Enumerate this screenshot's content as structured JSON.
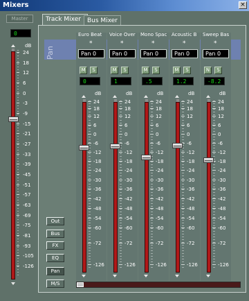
{
  "window": {
    "title": "Mixers",
    "close_glyph": "×"
  },
  "master": {
    "label": "Master",
    "value": "0",
    "level_db": 0
  },
  "tabs": [
    {
      "label": "Track Mixer",
      "active": true
    },
    {
      "label": "Bus Mixer",
      "active": false
    }
  ],
  "pan_section_label": "Pan",
  "channels": [
    {
      "name": "Euro Beat",
      "pan": "Pan 0",
      "mute": "M",
      "solo": "S",
      "value": "0",
      "level_db": 0
    },
    {
      "name": "Voice Over",
      "pan": "Pan 0",
      "mute": "M",
      "solo": "S",
      "value": "1",
      "level_db": 1
    },
    {
      "name": "Mono Spac",
      "pan": "Pan 0",
      "mute": "M",
      "solo": "S",
      "value": ".5",
      "level_db": -6.5
    },
    {
      "name": "Acoustic B",
      "pan": "Pan 0",
      "mute": "M",
      "solo": "S",
      "value": "1.2",
      "level_db": 1.2
    },
    {
      "name": "Sweep Bas",
      "pan": "Pan 0",
      "mute": "N",
      "solo": "S",
      "value": "-8.2",
      "level_db": -8.2
    }
  ],
  "pan_star": "*",
  "side_buttons": [
    {
      "label": "Out",
      "active": false
    },
    {
      "label": "Bus",
      "active": false
    },
    {
      "label": "FX",
      "active": false
    },
    {
      "label": "EQ",
      "active": false
    },
    {
      "label": "Pan",
      "active": true
    },
    {
      "label": "M/S",
      "active": false
    }
  ],
  "channel_scale": {
    "unit": "dB",
    "labels": [
      "24",
      "18",
      "12",
      "6",
      "0",
      "-6",
      "-12",
      "-18",
      "-24",
      "-30",
      "-36",
      "-42",
      "-48",
      "-54",
      "-60",
      "-72",
      "-126"
    ]
  },
  "master_scale": {
    "unit": "dB",
    "labels": [
      "24",
      "18",
      "12",
      "6",
      "0",
      "-3",
      "-9",
      "-15",
      "-21",
      "-27",
      "-33",
      "-39",
      "-45",
      "-51",
      "-57",
      "-63",
      "-69",
      "-75",
      "-81",
      "-93",
      "-105",
      "-126"
    ]
  },
  "colors": {
    "meter_red": "#b01818",
    "value_green": "#18d818",
    "pan_band": "#6e81b0",
    "titlebar": "#123a78"
  }
}
